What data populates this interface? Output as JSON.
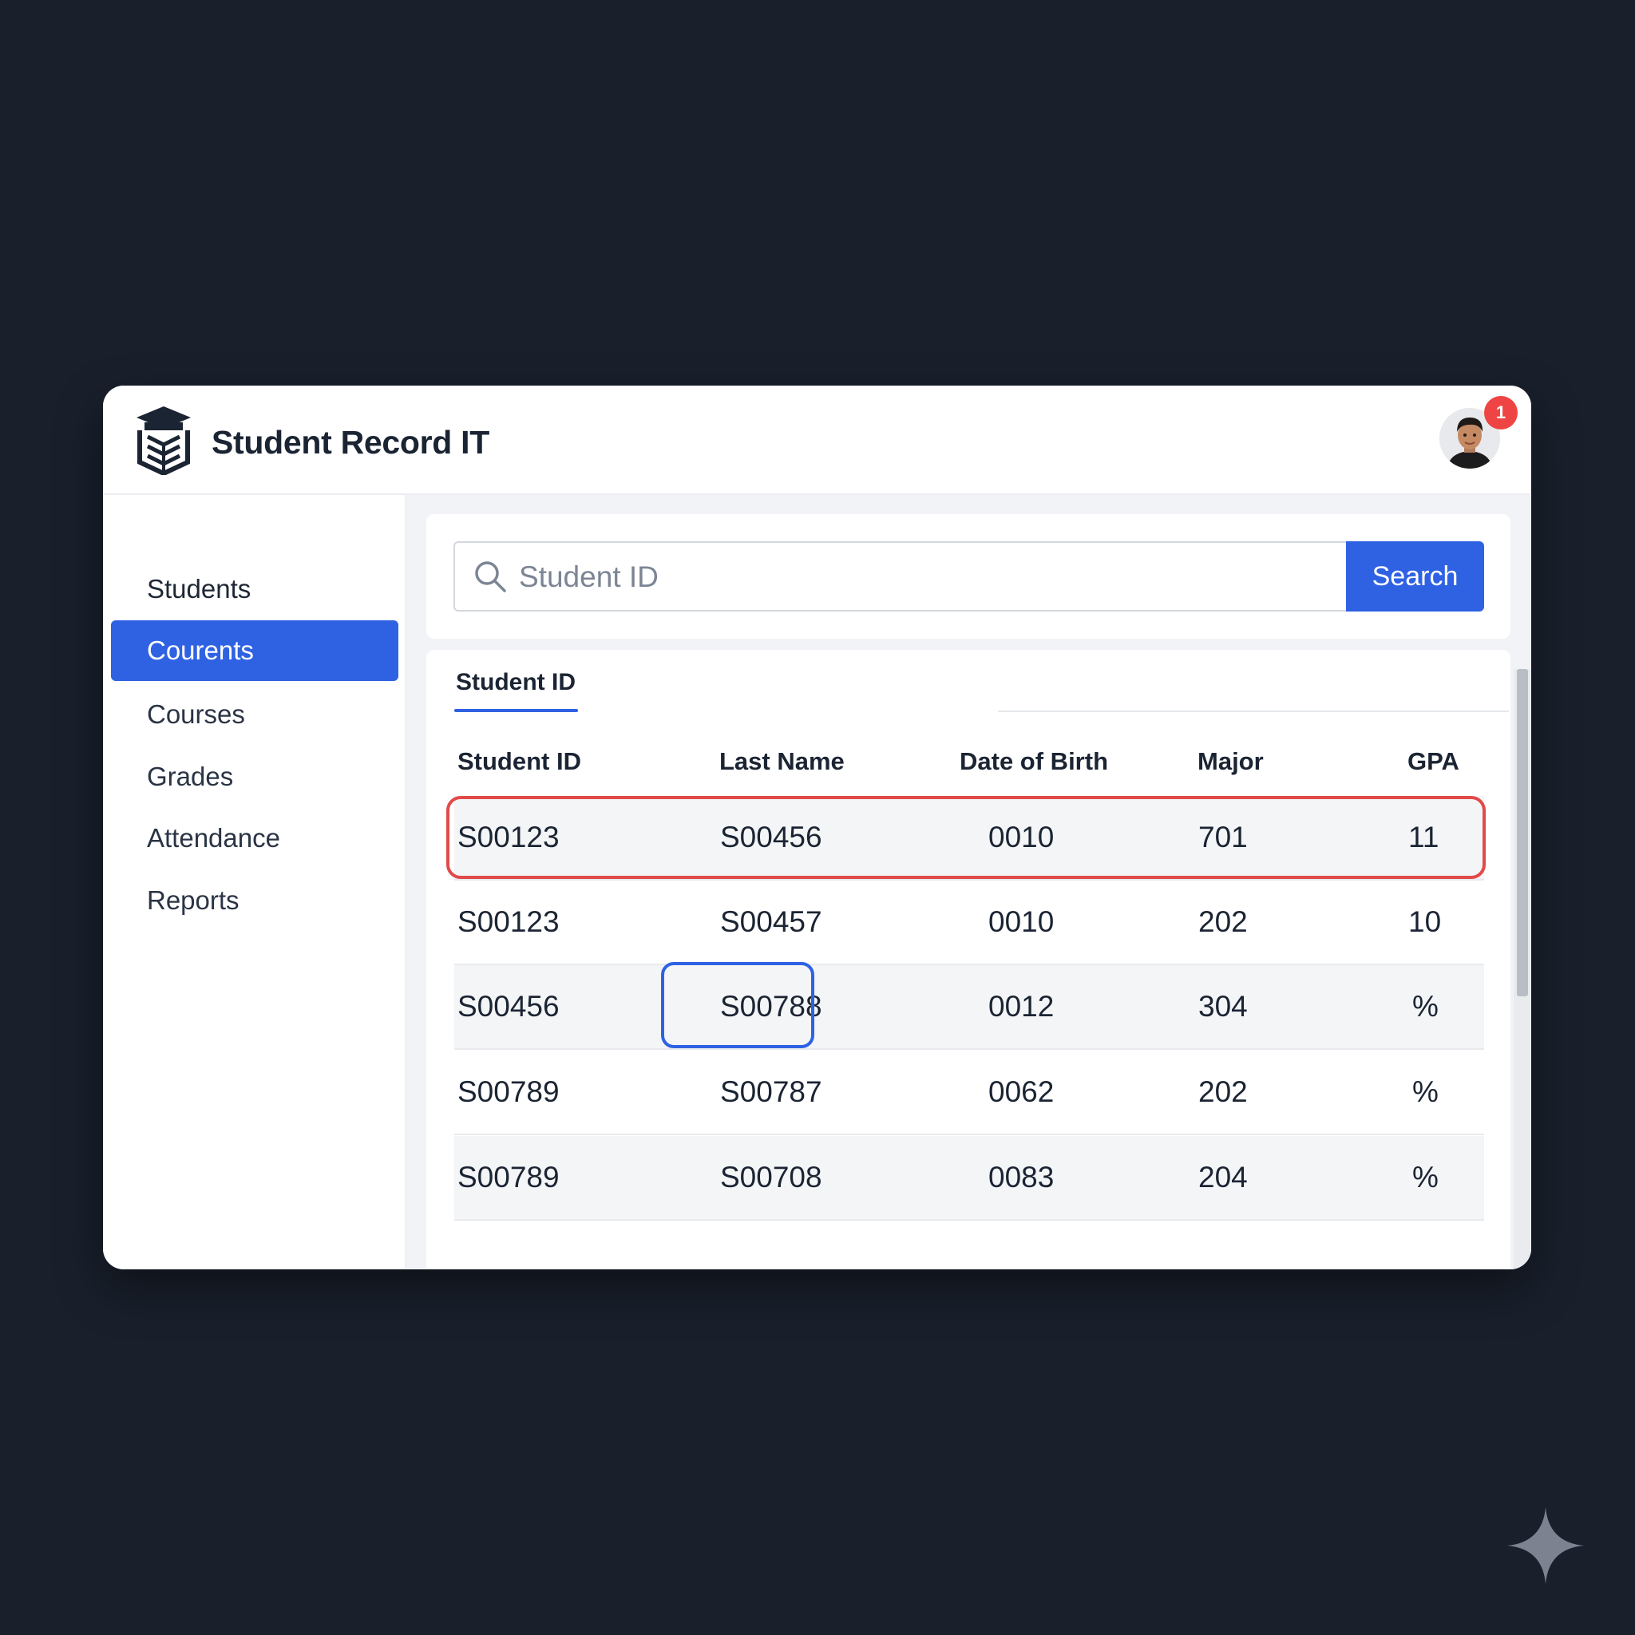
{
  "app": {
    "title": "Student Record IT",
    "notification_count": "1"
  },
  "sidebar": {
    "items": [
      {
        "label": "Students"
      },
      {
        "label": "Courents",
        "active": true
      },
      {
        "label": "Courses"
      },
      {
        "label": "Grades"
      },
      {
        "label": "Attendance"
      },
      {
        "label": "Reports"
      }
    ]
  },
  "search": {
    "placeholder": "Student ID",
    "value": "",
    "button_label": "Search"
  },
  "table": {
    "tab_label": "Student ID",
    "columns": [
      "Student ID",
      "Last Name",
      "Date of Birth",
      "Major",
      "GPA"
    ],
    "rows": [
      [
        "S00123",
        "S00456",
        "0010",
        "701",
        "11"
      ],
      [
        "S00123",
        "S00457",
        "0010",
        "202",
        "10"
      ],
      [
        "S00456",
        "S00788",
        "0012",
        "304",
        "%"
      ],
      [
        "S00789",
        "S00787",
        "0062",
        "202",
        "%"
      ],
      [
        "S00789",
        "S00708",
        "0083",
        "204",
        "%"
      ]
    ],
    "highlighted_row": 0,
    "highlighted_cell": {
      "row": 2,
      "column": 1
    }
  },
  "colors": {
    "accent": "#2f62e3",
    "row_highlight": "#e24a4a",
    "badge": "#ef4444",
    "background": "#19202c"
  },
  "icons": {
    "logo": "graduation-cap-book-icon",
    "search": "search-icon",
    "avatar": "user-avatar",
    "watermark": "sparkle-icon"
  }
}
